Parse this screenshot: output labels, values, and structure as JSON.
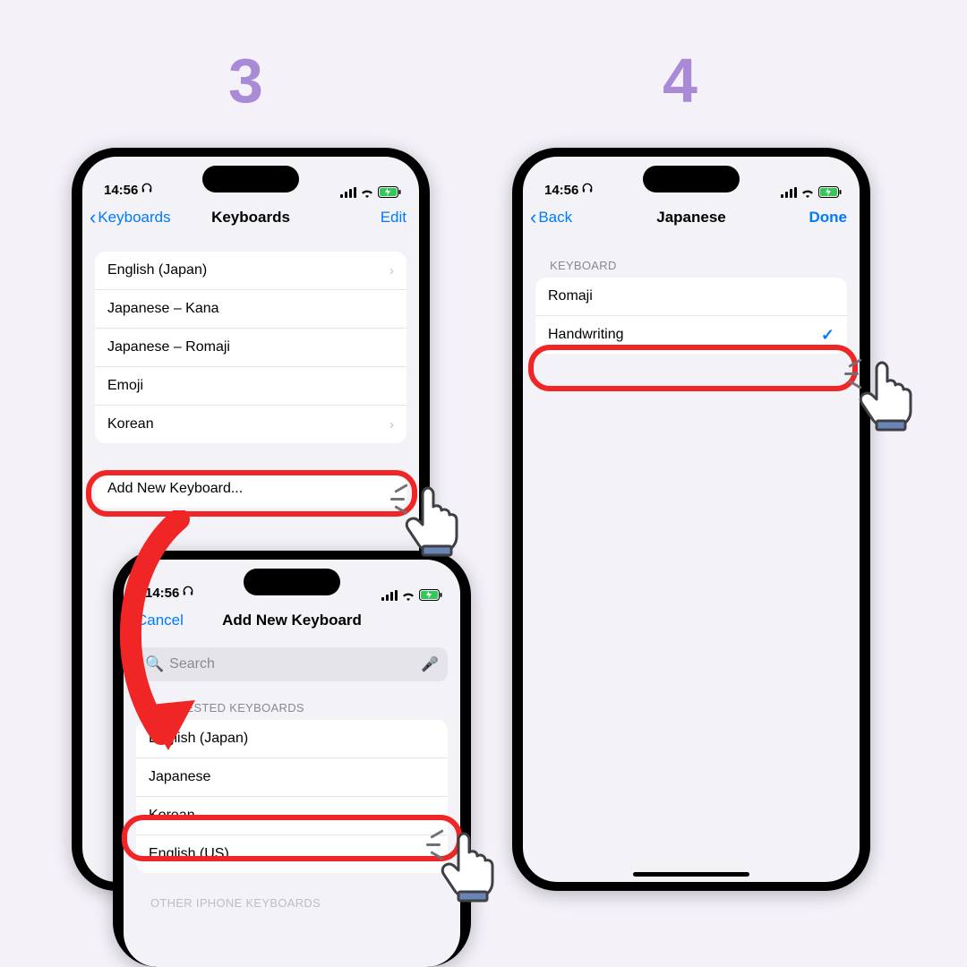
{
  "steps": {
    "s3": "3",
    "s4": "4"
  },
  "status": {
    "time": "14:56"
  },
  "phone3a": {
    "back": "Keyboards",
    "title": "Keyboards",
    "edit": "Edit",
    "rows": [
      {
        "label": "English (Japan)",
        "disc": true
      },
      {
        "label": "Japanese – Kana",
        "disc": false
      },
      {
        "label": "Japanese – Romaji",
        "disc": false
      },
      {
        "label": "Emoji",
        "disc": false
      },
      {
        "label": "Korean",
        "disc": true
      }
    ],
    "addnew": "Add New Keyboard..."
  },
  "phone3b": {
    "cancel": "Cancel",
    "title": "Add New Keyboard",
    "search_placeholder": "Search",
    "header_suggested": "SUGGESTED KEYBOARDS",
    "rows": [
      {
        "label": "English (Japan)"
      },
      {
        "label": "Japanese"
      },
      {
        "label": "Korean"
      },
      {
        "label": "English (US)"
      }
    ],
    "header_other": "OTHER IPHONE KEYBOARDS"
  },
  "phone4": {
    "back": "Back",
    "title": "Japanese",
    "done": "Done",
    "header": "KEYBOARD",
    "rows": [
      {
        "label": "Romaji",
        "checked": false
      },
      {
        "label": "Handwriting",
        "checked": true
      }
    ]
  }
}
